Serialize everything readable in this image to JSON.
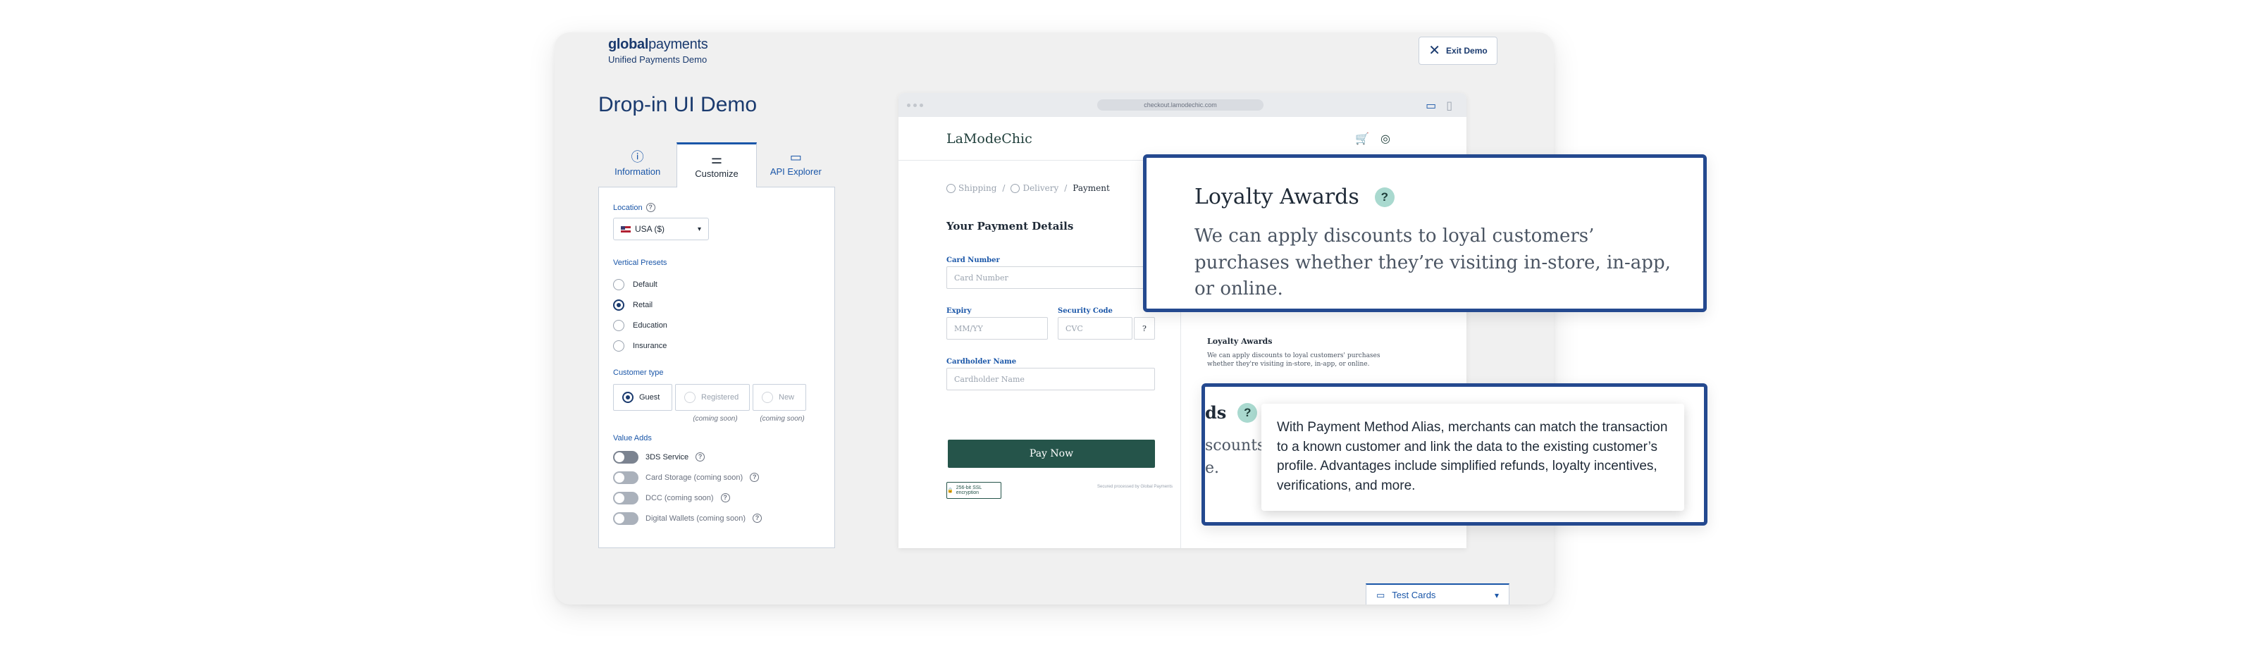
{
  "brand": {
    "logo_bold": "global",
    "logo_light": "payments",
    "subtitle": "Unified Payments Demo"
  },
  "exit_label": "Exit Demo",
  "page_title": "Drop-in UI Demo",
  "tabs": [
    {
      "label": "Information",
      "icon": "info-icon"
    },
    {
      "label": "Customize",
      "icon": "sliders-icon"
    },
    {
      "label": "API Explorer",
      "icon": "code-window-icon"
    }
  ],
  "location": {
    "label": "Location",
    "value": "USA ($)"
  },
  "vertical_presets": {
    "label": "Vertical Presets",
    "options": [
      "Default",
      "Retail",
      "Education",
      "Insurance"
    ],
    "selected": "Retail"
  },
  "customer_type": {
    "label": "Customer type",
    "options": [
      "Guest",
      "Registered",
      "New"
    ],
    "selected": "Guest",
    "soon_labels": [
      "(coming soon)",
      "(coming soon)"
    ]
  },
  "value_adds": {
    "label": "Value Adds",
    "items": [
      "3DS Service",
      "Card Storage (coming soon)",
      "DCC (coming soon)",
      "Digital Wallets (coming soon)"
    ]
  },
  "browser": {
    "url": "checkout.lamodechic.com",
    "shop_name": "LaModeChic",
    "crumbs": [
      "Shipping",
      "/",
      "Delivery",
      "/",
      "Payment"
    ],
    "heading": "Your Payment Details",
    "card_number_label": "Card Number",
    "card_number_placeholder": "Card Number",
    "expiry_label": "Expiry",
    "expiry_placeholder": "MM/YY",
    "security_label": "Security Code",
    "security_placeholder": "CVC",
    "cardholder_label": "Cardholder Name",
    "cardholder_placeholder": "Cardholder Name",
    "pay_label": "Pay Now",
    "secure_label": "256-bit SSL encryption",
    "powered_label": "Secured processed by Global Payments",
    "mini_loyal_title": "Loyalty Awards",
    "mini_loyal_desc": "We can apply discounts to loyal customers' purchases whether they're visiting in-store, in-app, or online."
  },
  "test_cards_label": "Test Cards",
  "callout_loyalty": {
    "title": "Loyalty Awards",
    "desc": "We can apply discounts to loyal customers’ purchases whether they’re visiting in-store, in-app, or online."
  },
  "callout_alias": {
    "bg_title": "ds",
    "bg_desc_line1": "scounts t",
    "bg_desc_line2": "e.",
    "tooltip": "With Payment Method Alias, merchants can match the transaction to a known customer and link the data to the existing customer’s profile. Advantages include simplified refunds, loyalty incentives, verifications, and more."
  },
  "colors": {
    "brand_navy": "#1a3a6e",
    "link_blue": "#1a56a8",
    "pay_green": "#25544a",
    "callout_border": "#24498f",
    "help_badge": "#a9d9cf"
  }
}
